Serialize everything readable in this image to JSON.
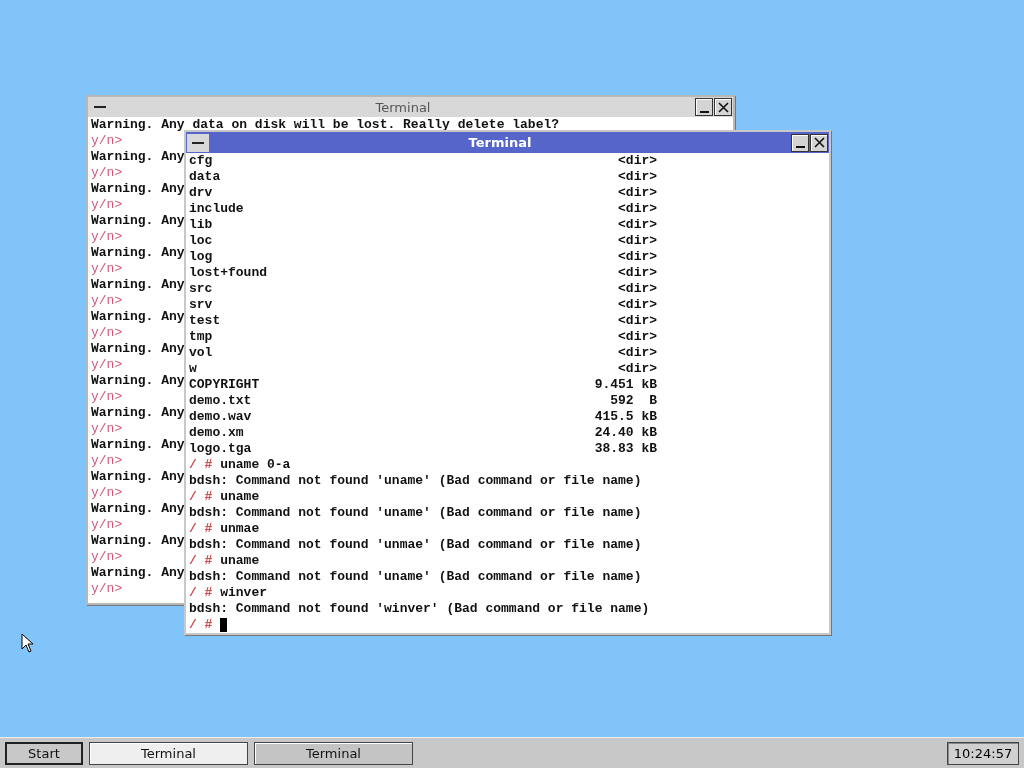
{
  "desktop": {
    "windows": [
      {
        "title": "Terminal",
        "active": false,
        "lines": [
          {
            "kind": "warning",
            "text": "Warning. Any data on disk will be lost. Really delete label?"
          },
          {
            "kind": "prompt",
            "text": "y/n>"
          },
          {
            "kind": "warning",
            "text": "Warning. Any"
          },
          {
            "kind": "prompt",
            "text": "y/n>"
          },
          {
            "kind": "warning",
            "text": "Warning. Any"
          },
          {
            "kind": "prompt",
            "text": "y/n>"
          },
          {
            "kind": "warning",
            "text": "Warning. Any"
          },
          {
            "kind": "prompt",
            "text": "y/n>"
          },
          {
            "kind": "warning",
            "text": "Warning. Any"
          },
          {
            "kind": "prompt",
            "text": "y/n>"
          },
          {
            "kind": "warning",
            "text": "Warning. Any"
          },
          {
            "kind": "prompt",
            "text": "y/n>"
          },
          {
            "kind": "warning",
            "text": "Warning. Any"
          },
          {
            "kind": "prompt",
            "text": "y/n>"
          },
          {
            "kind": "warning",
            "text": "Warning. Any"
          },
          {
            "kind": "prompt",
            "text": "y/n>"
          },
          {
            "kind": "warning",
            "text": "Warning. Any"
          },
          {
            "kind": "prompt",
            "text": "y/n>"
          },
          {
            "kind": "warning",
            "text": "Warning. Any"
          },
          {
            "kind": "prompt",
            "text": "y/n>"
          },
          {
            "kind": "warning",
            "text": "Warning. Any"
          },
          {
            "kind": "prompt",
            "text": "y/n>"
          },
          {
            "kind": "warning",
            "text": "Warning. Any"
          },
          {
            "kind": "prompt",
            "text": "y/n>"
          },
          {
            "kind": "warning",
            "text": "Warning. Any"
          },
          {
            "kind": "prompt",
            "text": "y/n>"
          },
          {
            "kind": "warning",
            "text": "Warning. Any"
          },
          {
            "kind": "prompt",
            "text": "y/n>"
          },
          {
            "kind": "warning",
            "text": "Warning. Any"
          },
          {
            "kind": "prompt",
            "text": "y/n>"
          }
        ]
      },
      {
        "title": "Terminal",
        "active": true,
        "lines": [
          {
            "kind": "entry",
            "name": "cfg",
            "size": "<dir>"
          },
          {
            "kind": "entry",
            "name": "data",
            "size": "<dir>"
          },
          {
            "kind": "entry",
            "name": "drv",
            "size": "<dir>"
          },
          {
            "kind": "entry",
            "name": "include",
            "size": "<dir>"
          },
          {
            "kind": "entry",
            "name": "lib",
            "size": "<dir>"
          },
          {
            "kind": "entry",
            "name": "loc",
            "size": "<dir>"
          },
          {
            "kind": "entry",
            "name": "log",
            "size": "<dir>"
          },
          {
            "kind": "entry",
            "name": "lost+found",
            "size": "<dir>"
          },
          {
            "kind": "entry",
            "name": "src",
            "size": "<dir>"
          },
          {
            "kind": "entry",
            "name": "srv",
            "size": "<dir>"
          },
          {
            "kind": "entry",
            "name": "test",
            "size": "<dir>"
          },
          {
            "kind": "entry",
            "name": "tmp",
            "size": "<dir>"
          },
          {
            "kind": "entry",
            "name": "vol",
            "size": "<dir>"
          },
          {
            "kind": "entry",
            "name": "w",
            "size": "<dir>"
          },
          {
            "kind": "entry",
            "name": "COPYRIGHT",
            "size": "9.451 kB"
          },
          {
            "kind": "entry",
            "name": "demo.txt",
            "size": "592  B"
          },
          {
            "kind": "entry",
            "name": "demo.wav",
            "size": "415.5 kB"
          },
          {
            "kind": "entry",
            "name": "demo.xm",
            "size": "24.40 kB"
          },
          {
            "kind": "entry",
            "name": "logo.tga",
            "size": "38.83 kB"
          },
          {
            "kind": "command",
            "prompt": "/ #",
            "command": "uname 0-a"
          },
          {
            "kind": "output",
            "text": "bdsh: Command not found 'uname' (Bad command or file name)"
          },
          {
            "kind": "command",
            "prompt": "/ #",
            "command": "uname"
          },
          {
            "kind": "output",
            "text": "bdsh: Command not found 'uname' (Bad command or file name)"
          },
          {
            "kind": "command",
            "prompt": "/ #",
            "command": "unmae"
          },
          {
            "kind": "output",
            "text": "bdsh: Command not found 'unmae' (Bad command or file name)"
          },
          {
            "kind": "command",
            "prompt": "/ #",
            "command": "uname"
          },
          {
            "kind": "output",
            "text": "bdsh: Command not found 'uname' (Bad command or file name)"
          },
          {
            "kind": "command",
            "prompt": "/ #",
            "command": "winver"
          },
          {
            "kind": "output",
            "text": "bdsh: Command not found 'winver' (Bad command or file name)"
          },
          {
            "kind": "command",
            "prompt": "/ #",
            "cursor": true
          }
        ]
      }
    ]
  },
  "taskbar": {
    "start": "Start",
    "tasks": [
      {
        "label": "Terminal",
        "selected": true
      },
      {
        "label": "Terminal",
        "selected": false
      }
    ],
    "clock": "10:24:57"
  }
}
